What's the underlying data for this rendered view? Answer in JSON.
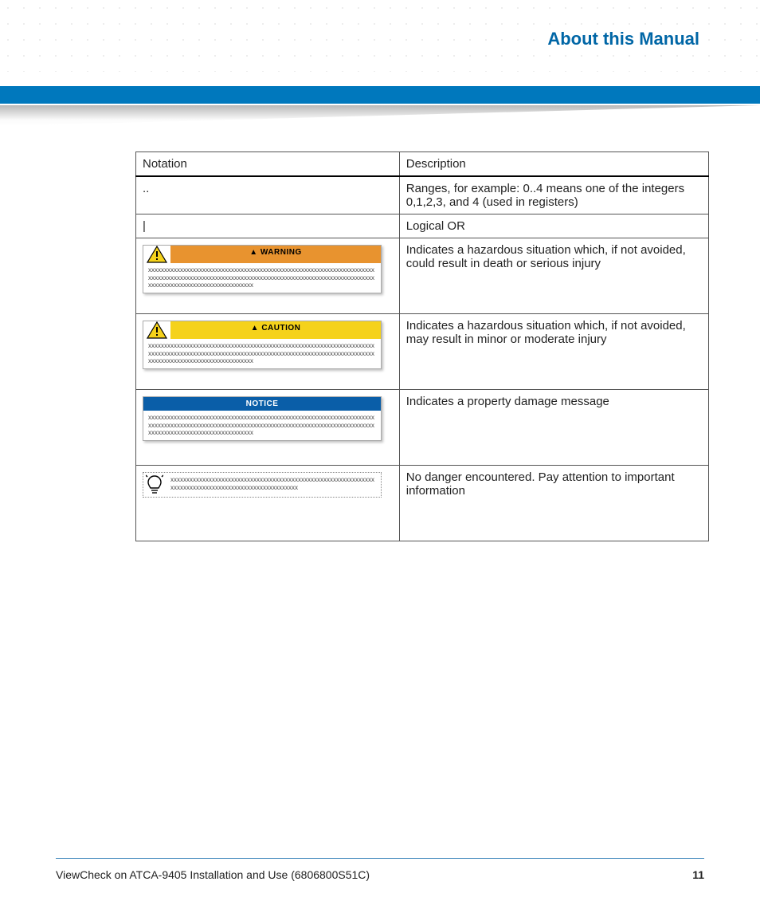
{
  "header": {
    "title": "About this Manual"
  },
  "table": {
    "columns": [
      "Notation",
      "Description"
    ],
    "rows": [
      {
        "notation": "..",
        "description": "Ranges, for example: 0..4 means one of the integers 0,1,2,3, and 4 (used in registers)"
      },
      {
        "notation": "|",
        "description": "Logical OR"
      },
      {
        "callout": {
          "type": "warning",
          "label": "WARNING",
          "bg": "#e8932f",
          "placeholder": "xxxxxxxxxxxxxxxxxxxxxxxxxxxxxxxxxxxxxxxxxxxxxxxxxxxxxxxxxxxxxxxxxxxxxxxxxxxxxxxxxxxxxxxxxxxxxxxxxxxxxxxxxxxxxxxxxxxxxxxxxxxxxxxxxxxxxxxxxxxxxxxxxxxxxxxxxxxxxxxxxxxxxxxxxxxxxxx"
        },
        "description": "Indicates a hazardous situation which, if not avoided, could result in death or serious injury"
      },
      {
        "callout": {
          "type": "caution",
          "label": "CAUTION",
          "bg": "#f5d21b",
          "placeholder": "xxxxxxxxxxxxxxxxxxxxxxxxxxxxxxxxxxxxxxxxxxxxxxxxxxxxxxxxxxxxxxxxxxxxxxxxxxxxxxxxxxxxxxxxxxxxxxxxxxxxxxxxxxxxxxxxxxxxxxxxxxxxxxxxxxxxxxxxxxxxxxxxxxxxxxxxxxxxxxxxxxxxxxxxxxxxxxx"
        },
        "description": "Indicates a hazardous situation which, if not avoided, may result in minor or moderate injury"
      },
      {
        "callout": {
          "type": "notice",
          "label": "NOTICE",
          "bg": "#0a5ea8",
          "placeholder": "xxxxxxxxxxxxxxxxxxxxxxxxxxxxxxxxxxxxxxxxxxxxxxxxxxxxxxxxxxxxxxxxxxxxxxxxxxxxxxxxxxxxxxxxxxxxxxxxxxxxxxxxxxxxxxxxxxxxxxxxxxxxxxxxxxxxxxxxxxxxxxxxxxxxxxxxxxxxxxxxxxxxxxxxxxxxxxx"
        },
        "description": "Indicates a property damage message"
      },
      {
        "callout": {
          "type": "tip",
          "label": "",
          "bg": "#ffffff",
          "placeholder": "xxxxxxxxxxxxxxxxxxxxxxxxxxxxxxxxxxxxxxxxxxxxxxxxxxxxxxxxxxxxxxxxxxxxxxxxxxxxxxxxxxxxxxxxxxxxxxxxxxxxxxxx"
        },
        "description": "No danger encountered. Pay attention to important information"
      }
    ]
  },
  "footer": {
    "doc": "ViewCheck on ATCA-9405 Installation and Use (6806800S51C)",
    "page": "11"
  }
}
